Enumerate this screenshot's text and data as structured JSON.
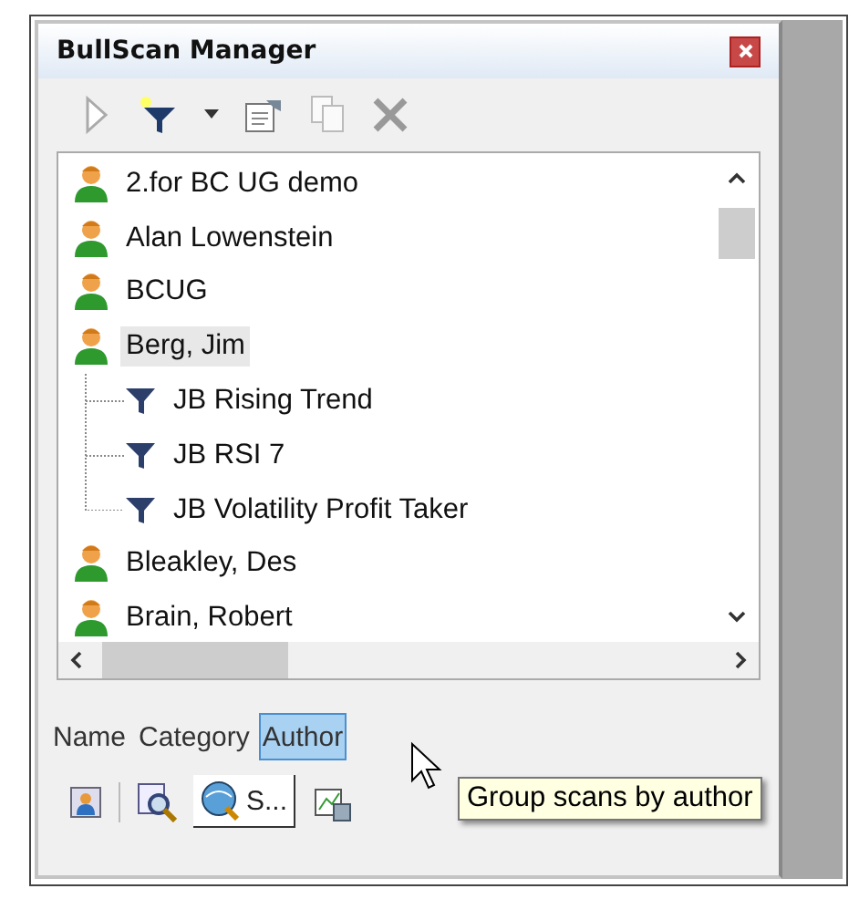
{
  "window": {
    "title": "BullScan Manager"
  },
  "toolbar": [
    {
      "kind": "run",
      "disabled": true
    },
    {
      "kind": "new-filter",
      "disabled": false
    },
    {
      "kind": "dropdown",
      "disabled": false
    },
    {
      "kind": "properties",
      "disabled": false
    },
    {
      "kind": "copy",
      "disabled": true
    },
    {
      "kind": "delete",
      "disabled": true
    }
  ],
  "tree": [
    {
      "label": "2.for BC UG demo",
      "selected": false
    },
    {
      "label": "Alan Lowenstein",
      "selected": false
    },
    {
      "label": "BCUG",
      "selected": false
    },
    {
      "label": "Berg, Jim",
      "selected": true,
      "children": [
        {
          "label": "JB Rising Trend"
        },
        {
          "label": "JB RSI 7"
        },
        {
          "label": "JB Volatility Profit Taker"
        }
      ]
    },
    {
      "label": "Bleakley, Des",
      "selected": false
    },
    {
      "label": "Brain, Robert",
      "selected": false
    }
  ],
  "group_tabs": [
    {
      "label": "Name",
      "selected": false
    },
    {
      "label": "Category",
      "selected": false
    },
    {
      "label": "Author",
      "selected": true
    }
  ],
  "bottom_tabs": [
    {
      "kind": "person",
      "selected": false
    },
    {
      "kind": "search",
      "selected": false
    },
    {
      "kind": "scan",
      "label": "S...",
      "selected": true
    },
    {
      "kind": "chart",
      "selected": false
    }
  ],
  "tooltip": "Group scans by author"
}
